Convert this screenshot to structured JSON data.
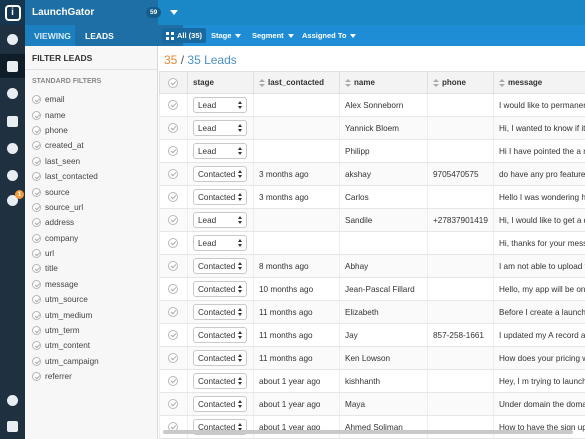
{
  "app": {
    "name": "LaunchGator",
    "badge": "59",
    "logo_text": "i"
  },
  "subbar": {
    "viewing_label": "VIEWING",
    "view_selected": "LEADS",
    "all_filter": "All (35)",
    "stage_label": "Stage",
    "segment_label": "Segment",
    "assigned_label": "Assigned To"
  },
  "rail": {
    "icons": [
      "dashboard-icon",
      "leads-icon",
      "users-icon",
      "inbox-icon",
      "campaigns-icon",
      "chat-icon",
      "support-icon",
      "settings-icon",
      "favorites-icon"
    ],
    "notification_badge": "1",
    "accent_color": "#f29a3a"
  },
  "filters": {
    "title": "FILTER LEADS",
    "subtitle": "STANDARD FILTERS",
    "items": [
      "email",
      "name",
      "phone",
      "created_at",
      "last_seen",
      "last_contacted",
      "source",
      "source_url",
      "address",
      "company",
      "url",
      "title",
      "message",
      "utm_source",
      "utm_medium",
      "utm_term",
      "utm_content",
      "utm_campaign",
      "referrer"
    ]
  },
  "main": {
    "count_current": "35",
    "count_sep": "/",
    "count_total": "35 Leads",
    "columns": [
      "stage",
      "last_contacted",
      "name",
      "phone",
      "message"
    ],
    "rows": [
      {
        "stage": "Lead",
        "last_contacted": "",
        "name": "Alex Sonneborn",
        "phone": "",
        "message": "I would like to permanently clo"
      },
      {
        "stage": "Lead",
        "last_contacted": "",
        "name": "Yannick Bloem",
        "phone": "",
        "message": "Hi, I wanted to know if it was p"
      },
      {
        "stage": "Lead",
        "last_contacted": "",
        "name": "Philipp",
        "phone": "",
        "message": "Hi I have pointed the a record a"
      },
      {
        "stage": "Contacted",
        "last_contacted": "3 months ago",
        "name": "akshay",
        "phone": "9705470575",
        "message": "do have any pro feature for cus"
      },
      {
        "stage": "Contacted",
        "last_contacted": "3 months ago",
        "name": "Carlos",
        "phone": "",
        "message": "Hello I was wondering how I co"
      },
      {
        "stage": "Lead",
        "last_contacted": "",
        "name": "Sandile",
        "phone": "+27837901419",
        "message": "Hi, I would like to get a quote f"
      },
      {
        "stage": "Lead",
        "last_contacted": "",
        "name": "",
        "phone": "",
        "message": "Hi, thanks for your message. Ur"
      },
      {
        "stage": "Contacted",
        "last_contacted": "8 months ago",
        "name": "Abhay",
        "phone": "",
        "message": "I am not able to upload favicon"
      },
      {
        "stage": "Contacted",
        "last_contacted": "10 months ago",
        "name": "Jean-Pascal Fillard",
        "phone": "",
        "message": "Hello, my app will be on the ma"
      },
      {
        "stage": "Contacted",
        "last_contacted": "11 months ago",
        "name": "Elizabeth",
        "phone": "",
        "message": "Before I create a launch comin"
      },
      {
        "stage": "Contacted",
        "last_contacted": "11 months ago",
        "name": "Jay",
        "phone": "857-258-1661",
        "message": "I updated my A record at goDad"
      },
      {
        "stage": "Contacted",
        "last_contacted": "11 months ago",
        "name": "Ken Lowson",
        "phone": "",
        "message": "How does your pricing work? W"
      },
      {
        "stage": "Contacted",
        "last_contacted": "about 1 year ago",
        "name": "kishhanth",
        "phone": "",
        "message": "Hey, I m trying to launch my ap"
      },
      {
        "stage": "Contacted",
        "last_contacted": "about 1 year ago",
        "name": "Maya",
        "phone": "",
        "message": "Under domain the domain stat"
      },
      {
        "stage": "Contacted",
        "last_contacted": "about 1 year ago",
        "name": "Ahmed Soliman",
        "phone": "",
        "message": "How to have the sign up box w"
      }
    ]
  }
}
